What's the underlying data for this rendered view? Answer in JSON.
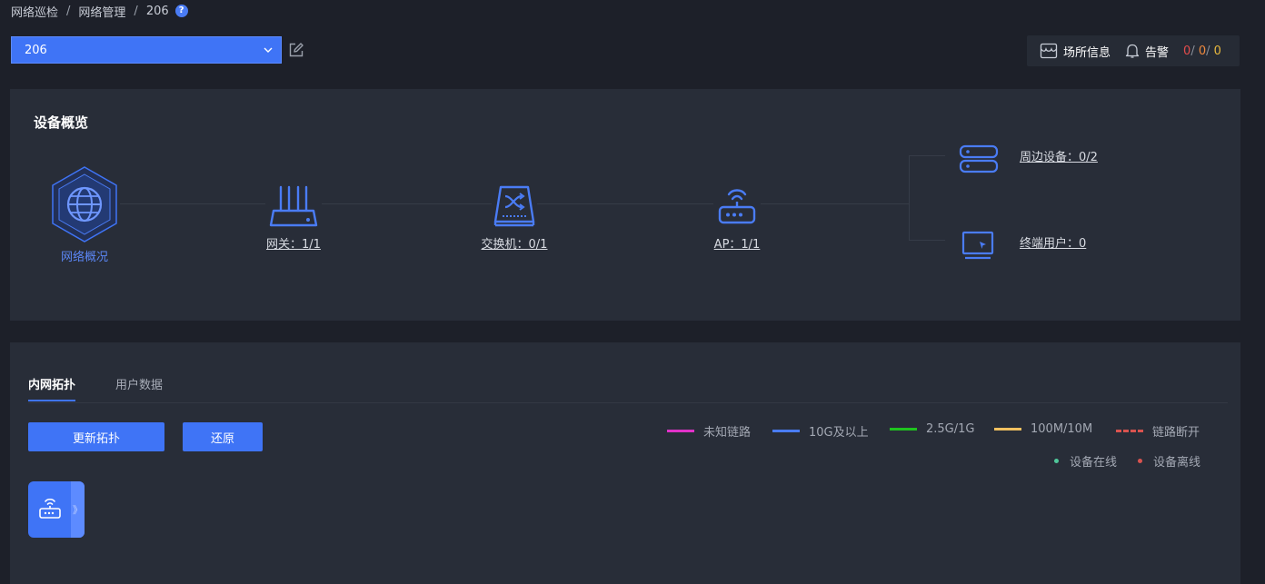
{
  "breadcrumb": {
    "items": [
      "网络巡检",
      "网络管理",
      "206"
    ],
    "separator": "/",
    "help": "?"
  },
  "site_select": {
    "value": "206"
  },
  "header": {
    "site_info": "场所信息",
    "alarm": "告警",
    "alarm_counts": [
      "0",
      "0",
      "0"
    ],
    "count_separator": "/"
  },
  "overview": {
    "title": "设备概览",
    "network": "网络概况",
    "gateway": "网关：1/1",
    "switch": "交换机：0/1",
    "ap": "AP：1/1",
    "peripheral": "周边设备：0/2",
    "terminal": "终端用户：0"
  },
  "topology": {
    "tabs": [
      "内网拓扑",
      "用户数据"
    ],
    "update_button": "更新拓扑",
    "restore_button": "还原",
    "legend": {
      "unknown": "未知链路",
      "g10": "10G及以上",
      "g25": "2.5G/1G",
      "m100": "100M/10M",
      "down": "链路断开",
      "online": "设备在线",
      "offline": "设备离线"
    },
    "node_expand": "》"
  },
  "colors": {
    "accent": "#3f74f6",
    "unknown_link": "#e032c8",
    "g10_link": "#4a7cf5",
    "g25_link": "#1fc31f",
    "m100_link": "#f0c060",
    "down_link": "#d9534f",
    "online": "#4fc79a",
    "offline": "#d9534f"
  }
}
